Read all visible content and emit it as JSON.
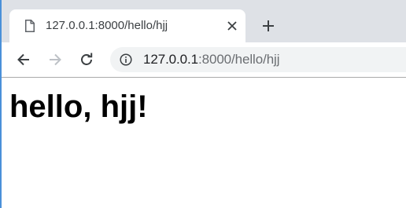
{
  "tab": {
    "title": "127.0.0.1:8000/hello/hjj",
    "page_icon": "page-icon",
    "close_icon": "close-icon"
  },
  "new_tab": {
    "icon": "plus-icon"
  },
  "toolbar": {
    "back_icon": "back-arrow-icon",
    "forward_icon": "forward-arrow-icon",
    "reload_icon": "reload-icon"
  },
  "address_bar": {
    "info_icon": "info-icon",
    "host": "127.0.0.1",
    "rest": ":8000/hello/hjj"
  },
  "page": {
    "heading": "hello, hjj!"
  }
}
